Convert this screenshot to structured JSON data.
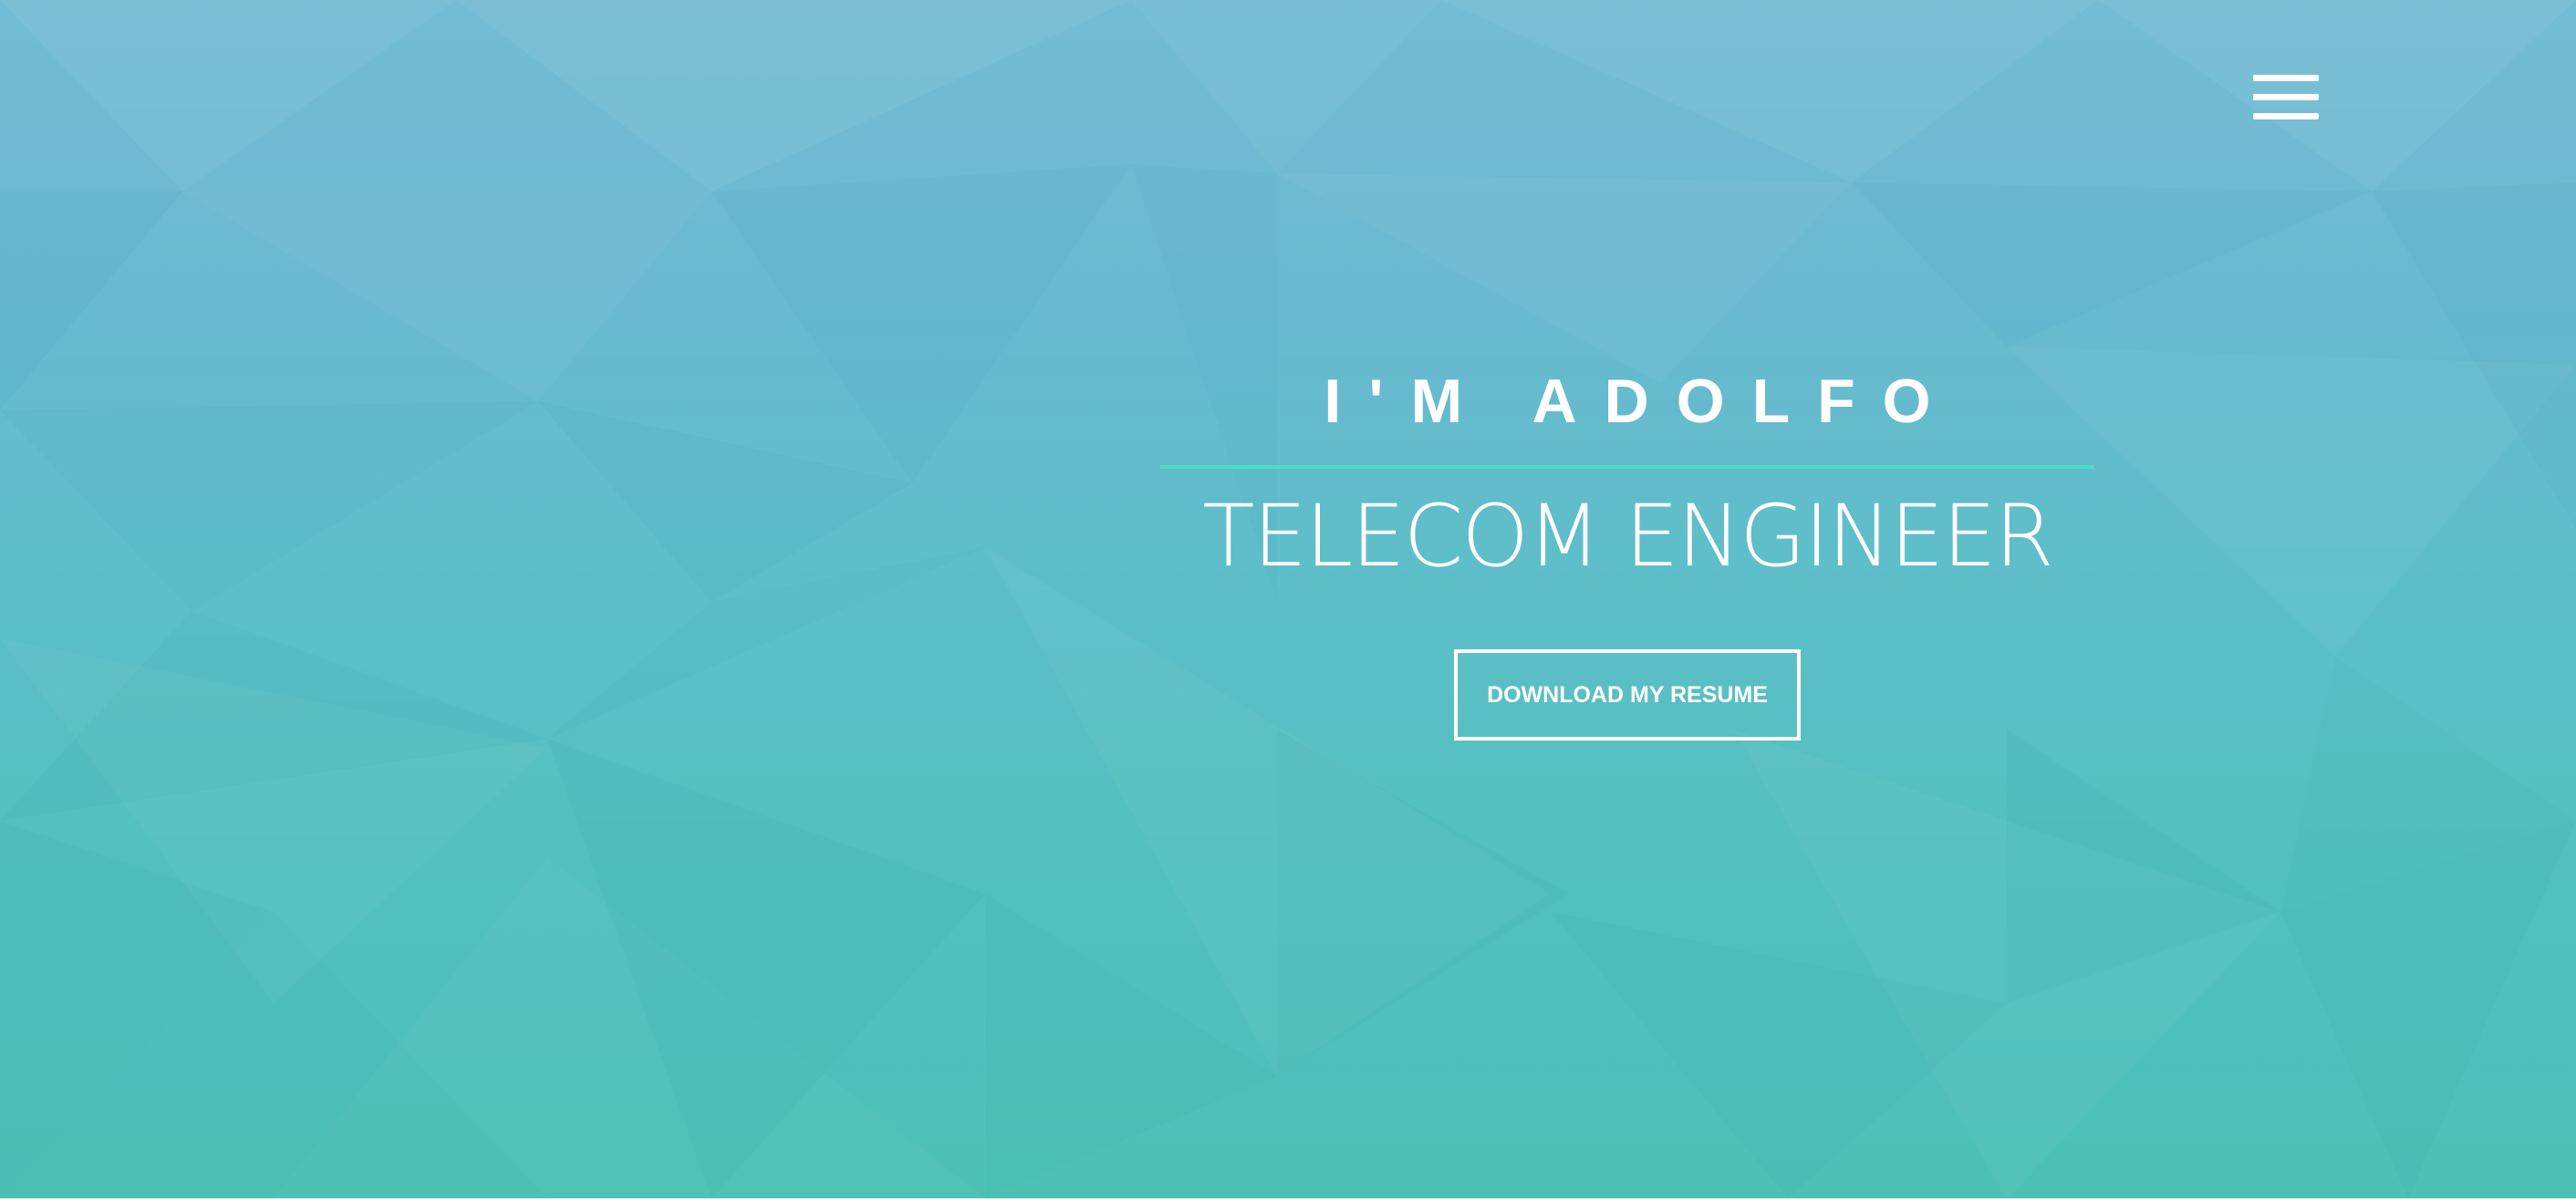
{
  "header": {
    "menu_icon": "hamburger-menu-icon"
  },
  "hero": {
    "greeting": "I'M ADOLFO",
    "title": "TELECOM ENGINEER",
    "resume_button_label": "DOWNLOAD MY RESUME"
  },
  "colors": {
    "gradient_top": "#74bcd3",
    "gradient_bottom": "#4dc1b6",
    "divider": "#48e0c4",
    "text": "#ffffff"
  }
}
